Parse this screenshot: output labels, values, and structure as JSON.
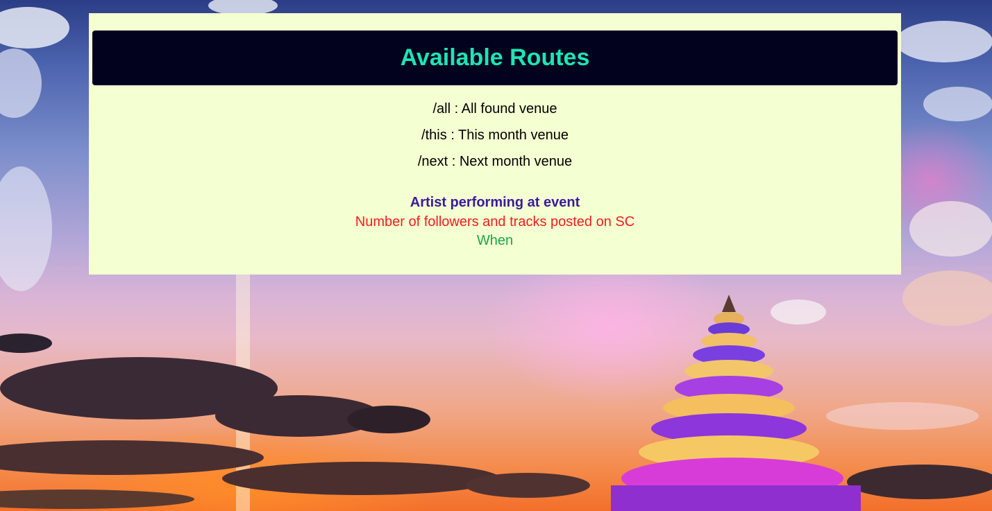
{
  "panel": {
    "title": "Available Routes",
    "routes": [
      {
        "label": "/all : All found venue"
      },
      {
        "label": "/this : This month venue"
      },
      {
        "label": "/next : Next month venue"
      }
    ],
    "legend": {
      "artist": "Artist performing at event",
      "followers": "Number of followers and tracks posted on SC",
      "when": "When"
    }
  },
  "colors": {
    "panel_bg": "#f4ffd2",
    "header_bg": "#02021f",
    "title": "#1de5b4",
    "artist": "#3a1c97",
    "followers": "#f01c1c",
    "when": "#1aa54a"
  }
}
